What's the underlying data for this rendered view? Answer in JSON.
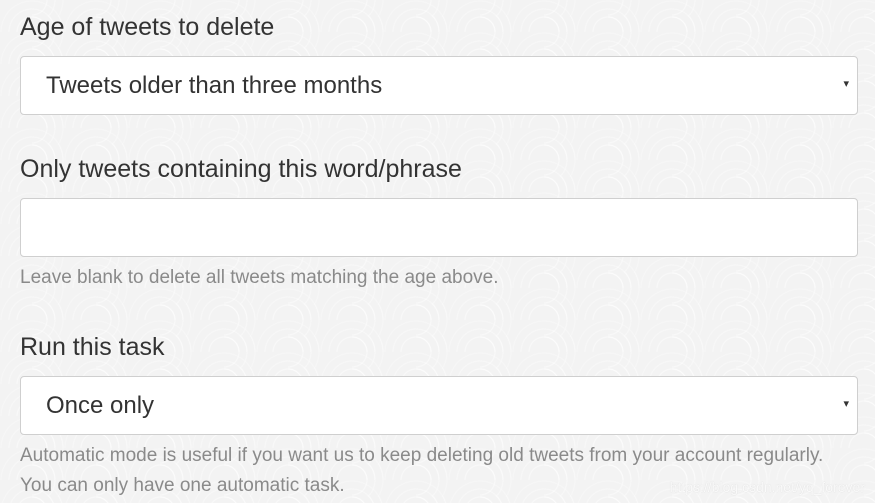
{
  "age_group": {
    "label": "Age of tweets to delete",
    "selected": "Tweets older than three months"
  },
  "phrase_group": {
    "label": "Only tweets containing this word/phrase",
    "value": "",
    "help": "Leave blank to delete all tweets matching the age above."
  },
  "run_group": {
    "label": "Run this task",
    "selected": "Once only",
    "help": "Automatic mode is useful if you want us to keep deleting old tweets from your account regularly. You can only have one automatic task."
  },
  "caret_glyph": "▾",
  "icons": {
    "dropdown": "chevron-down-icon"
  },
  "watermark": "https://blog.csdn.net/yq_forever"
}
